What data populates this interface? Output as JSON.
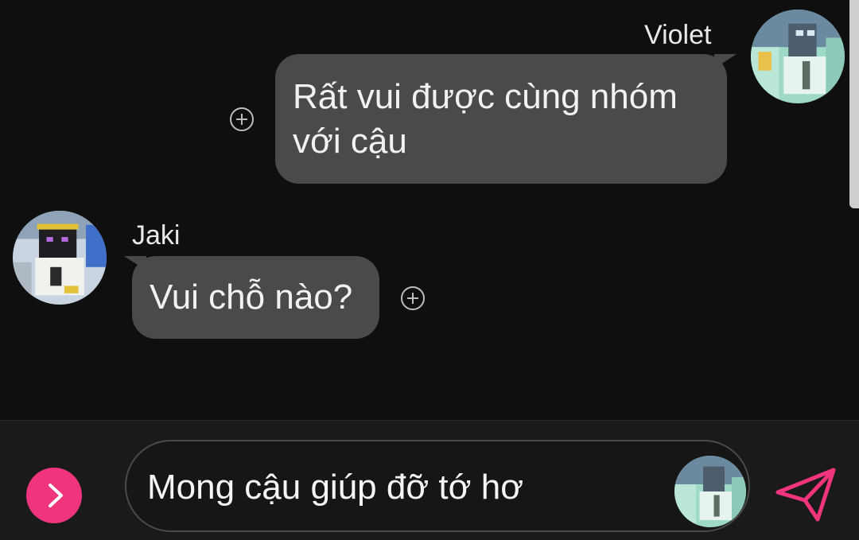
{
  "chat": {
    "messages": [
      {
        "sender": "Violet",
        "text_lines": [
          "Rất vui được cùng nhóm",
          "với cậu"
        ],
        "side": "right"
      },
      {
        "sender": "Jaki",
        "text_lines": [
          "Vui chỗ nào?"
        ],
        "side": "left"
      }
    ]
  },
  "composer": {
    "draft": "Mong cậu giúp đỡ tớ hơ",
    "menu_icon": "chevron-right-icon",
    "send_icon": "paper-plane-icon"
  },
  "colors": {
    "background": "#0f0f10",
    "bubble": "#4a4a4d",
    "accent": "#f0357d",
    "composer_bg": "#1a1a1b"
  }
}
